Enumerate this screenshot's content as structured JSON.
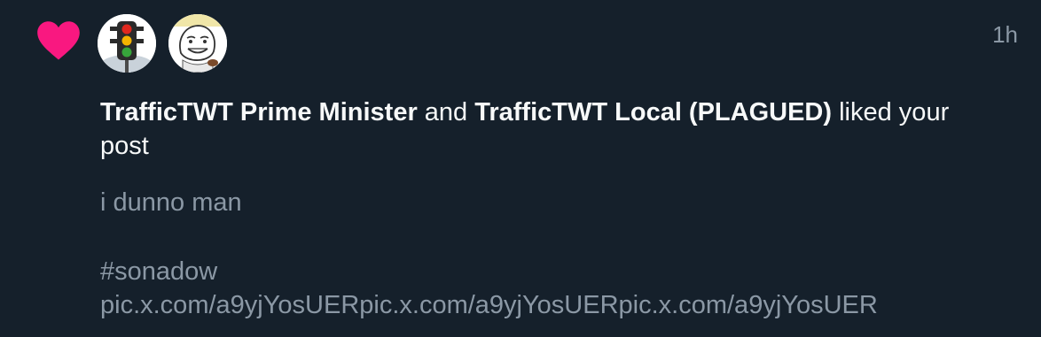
{
  "notification": {
    "type_icon": "heart-icon",
    "accent_color": "#f91880",
    "timestamp": "1h",
    "likers": [
      {
        "name": "TrafficTWT Prime Minister",
        "avatar_icon": "traffic-light-avatar"
      },
      {
        "name": "TrafficTWT Local (PLAGUED)",
        "avatar_icon": "meme-face-avatar"
      }
    ],
    "connector": "and",
    "action_text": "liked your post",
    "post_preview": {
      "text": "i dunno man",
      "hashtag": "#sonadow",
      "links": "pic.x.com/a9yjYosUERpic.x.com/a9yjYosUERpic.x.com/a9yjYosUER"
    }
  }
}
